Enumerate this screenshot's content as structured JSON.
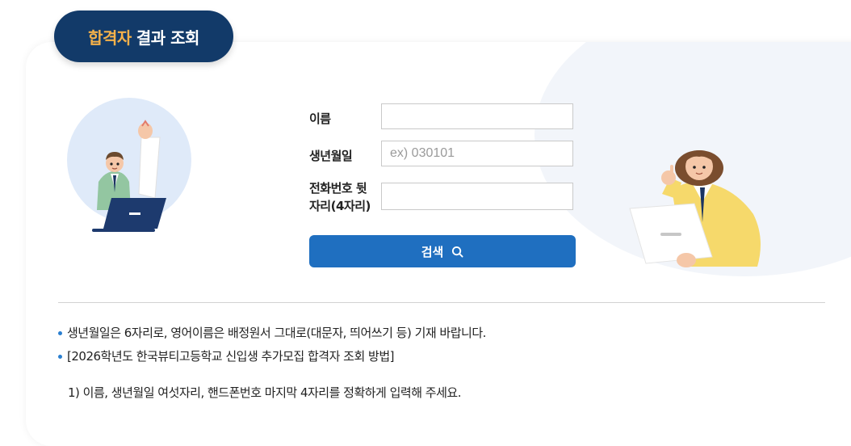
{
  "header": {
    "tab_highlight": "합격자",
    "tab_rest": "결과 조회"
  },
  "form": {
    "name_label": "이름",
    "name_value": "",
    "birth_label": "생년월일",
    "birth_placeholder": "ex) 030101",
    "phone_label_line1": "전화번호 뒷",
    "phone_label_line2": "자리(4자리)",
    "phone_value": "",
    "search_label": "검색"
  },
  "notes": {
    "items": [
      "생년월일은 6자리로, 영어이름은 배정원서 그대로(대문자, 띄어쓰기 등) 기재 바랍니다.",
      "[2026학년도 한국뷰티고등학교 신입생 추가모집 합격자 조회 방법]"
    ],
    "step1": "1) 이름, 생년월일 여섯자리, 핸드폰번호 마지막 4자리를 정확하게 입력해 주세요."
  },
  "colors": {
    "tab_bg": "#123a69",
    "tab_highlight": "#f5b14a",
    "button": "#1f6fc0",
    "bullet": "#2a7fd0"
  }
}
